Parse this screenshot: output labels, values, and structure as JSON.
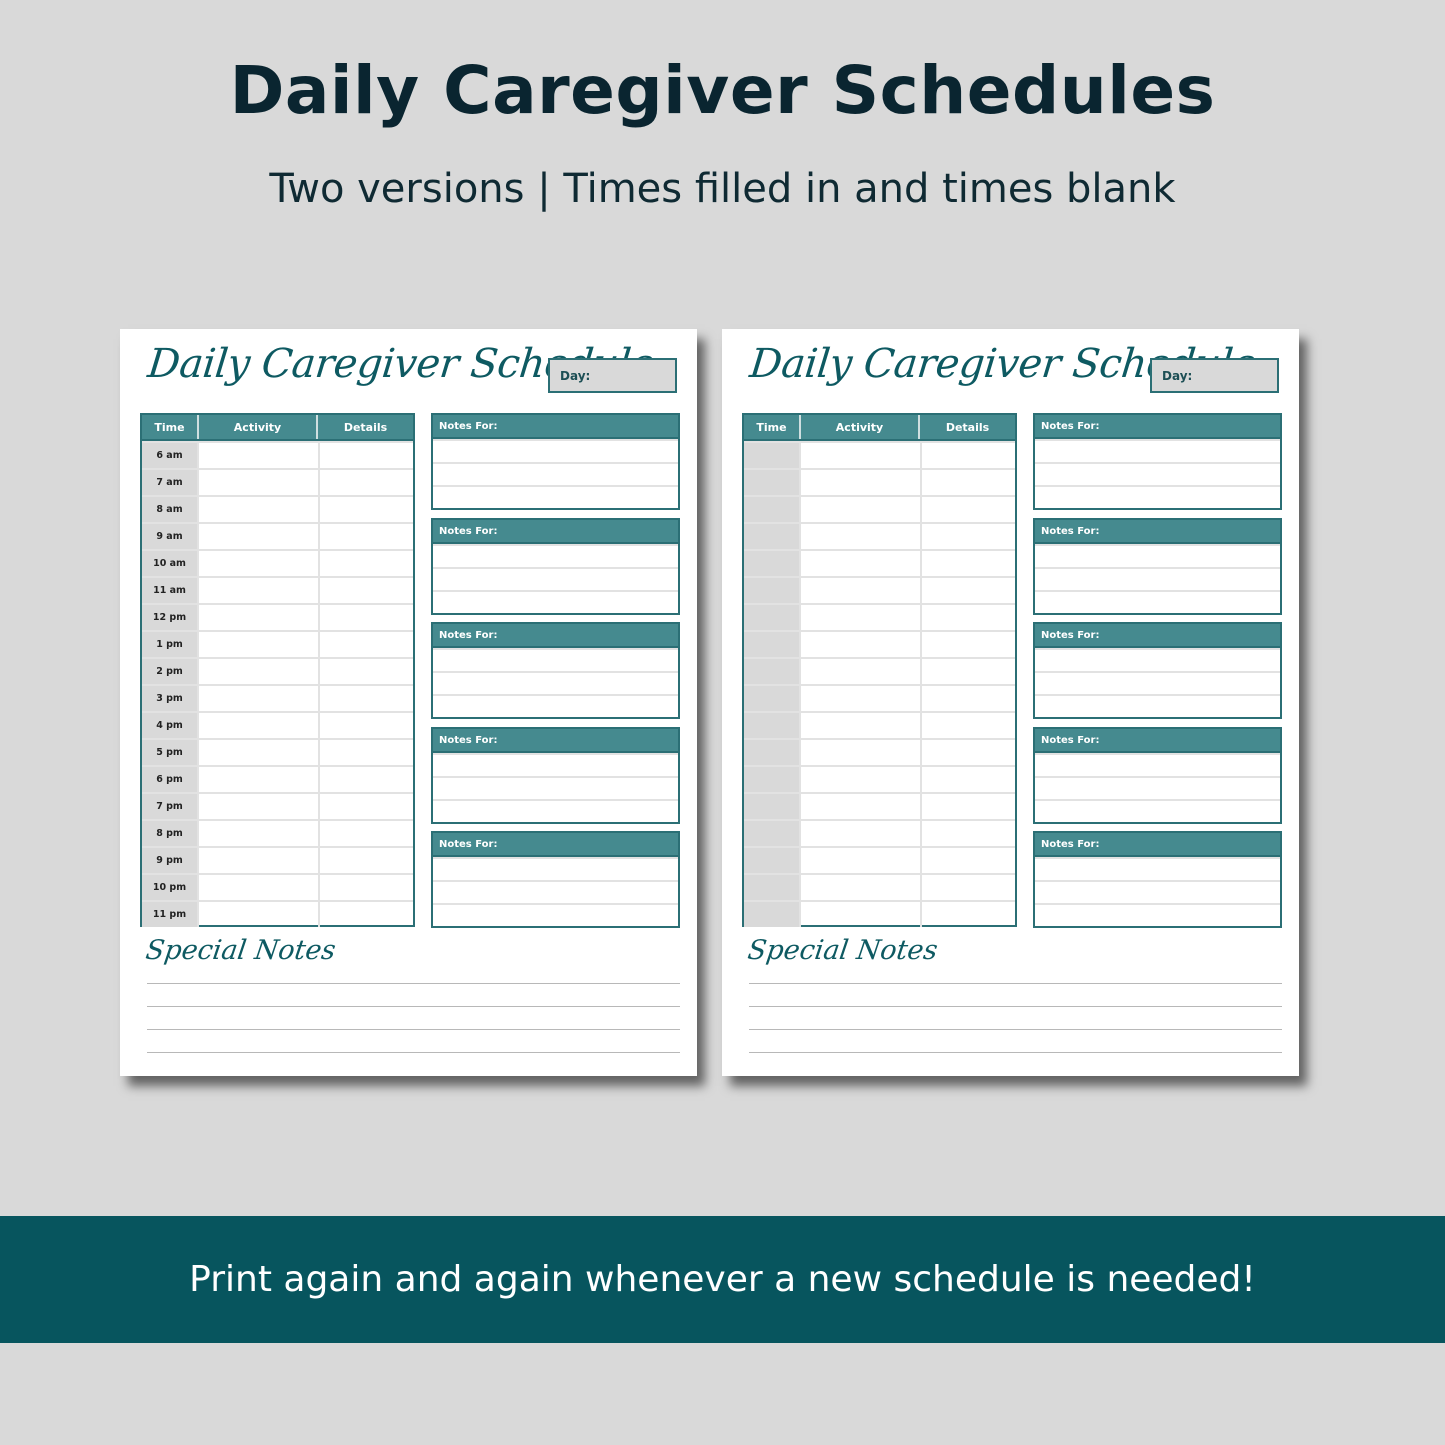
{
  "header": {
    "title": "Daily Caregiver Schedules",
    "subtitle": "Two versions | Times filled in and times blank"
  },
  "colors": {
    "background": "#d9d9d9",
    "teal_dark": "#07555e",
    "teal_header": "#458a8f",
    "teal_border": "#2b6f75",
    "title_text": "#0a2530"
  },
  "sheets": [
    {
      "version": "times-filled",
      "title": "Daily Caregiver Schedule",
      "day_label": "Day:",
      "columns": [
        "Time",
        "Activity",
        "Details"
      ],
      "times": [
        "6 am",
        "7 am",
        "8 am",
        "9 am",
        "10 am",
        "11 am",
        "12 pm",
        "1 pm",
        "2 pm",
        "3 pm",
        "4 pm",
        "5 pm",
        "6 pm",
        "7 pm",
        "8 pm",
        "9 pm",
        "10 pm",
        "11 pm"
      ],
      "notes_label": "Notes For:",
      "notes_boxes": 5,
      "special_notes_title": "Special Notes"
    },
    {
      "version": "times-blank",
      "title": "Daily Caregiver Schedule",
      "day_label": "Day:",
      "columns": [
        "Time",
        "Activity",
        "Details"
      ],
      "times": [
        "",
        "",
        "",
        "",
        "",
        "",
        "",
        "",
        "",
        "",
        "",
        "",
        "",
        "",
        "",
        "",
        "",
        ""
      ],
      "notes_label": "Notes For:",
      "notes_boxes": 5,
      "special_notes_title": "Special Notes"
    }
  ],
  "footer": {
    "banner_text": "Print again and again whenever a new schedule is needed!"
  }
}
